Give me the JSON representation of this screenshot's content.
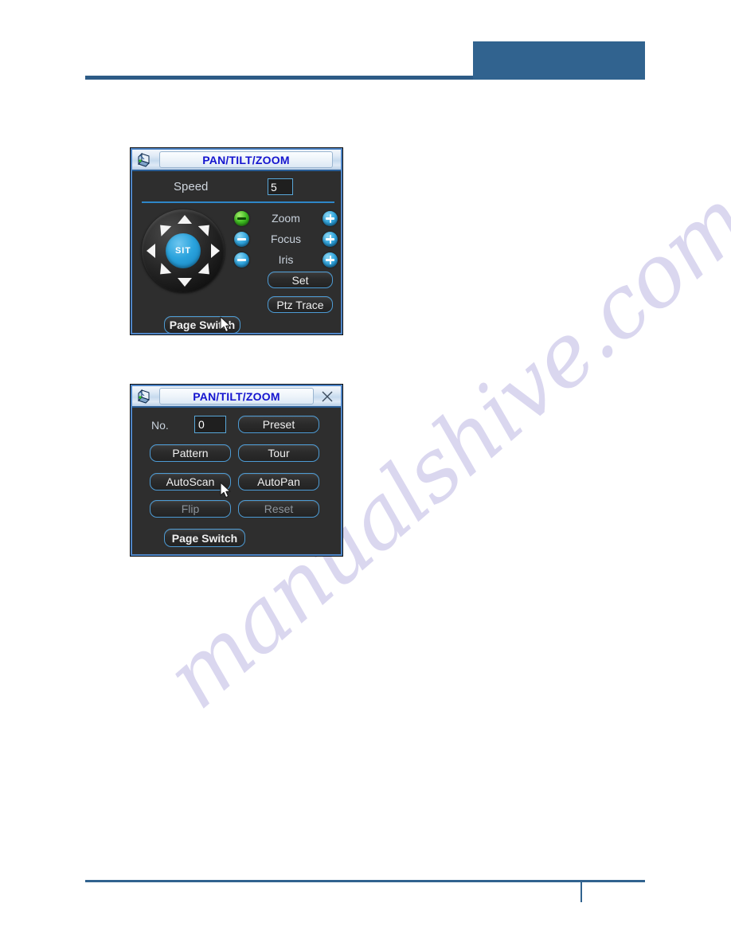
{
  "document": {
    "header_accent_color": "#31638f",
    "rule_color": "#2d5b86"
  },
  "watermark": {
    "text": "manualshive.com",
    "color": "#cdc8ea"
  },
  "panel_1": {
    "title": "PAN/TILT/ZOOM",
    "icon": "ptz-camera-cube-icon",
    "speed": {
      "label": "Speed",
      "value": "5"
    },
    "joystick": {
      "center_label": "SIT",
      "directions": [
        "up",
        "down",
        "left",
        "right",
        "up-left",
        "up-right",
        "down-left",
        "down-right"
      ]
    },
    "lens_controls": [
      {
        "label": "Zoom",
        "minus": "-",
        "plus": "+",
        "minus_color": "#3fbd22",
        "plus_color": "#33a6de"
      },
      {
        "label": "Focus",
        "minus": "-",
        "plus": "+",
        "minus_color": "#33a6de",
        "plus_color": "#33a6de"
      },
      {
        "label": "Iris",
        "minus": "-",
        "plus": "+",
        "minus_color": "#33a6de",
        "plus_color": "#33a6de"
      }
    ],
    "buttons": {
      "set": "Set",
      "ptz_trace": "Ptz Trace",
      "page_switch": "Page Switch"
    }
  },
  "panel_2": {
    "title": "PAN/TILT/ZOOM",
    "icon": "ptz-camera-cube-icon",
    "close_label": "×",
    "no_field": {
      "label": "No.",
      "value": "0"
    },
    "buttons": {
      "preset": "Preset",
      "pattern": "Pattern",
      "tour": "Tour",
      "autoscan": "AutoScan",
      "autopan": "AutoPan",
      "flip": "Flip",
      "reset": "Reset",
      "page_switch": "Page Switch"
    }
  }
}
